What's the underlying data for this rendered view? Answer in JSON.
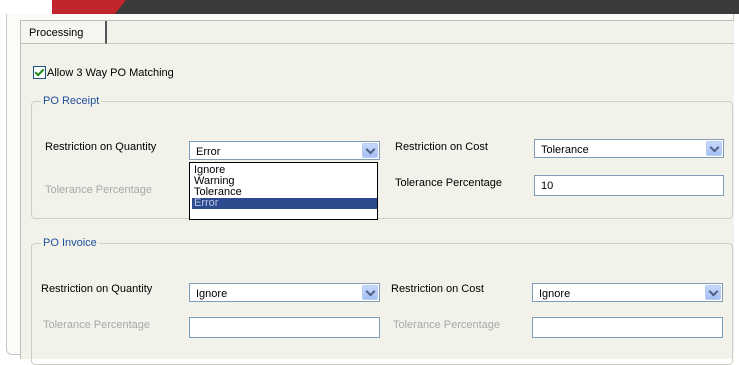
{
  "tabs": [
    {
      "label": "Processing"
    }
  ],
  "allow_3way": {
    "label": "Allow 3 Way PO Matching",
    "checked": true
  },
  "po_receipt": {
    "legend": "PO Receipt",
    "restriction_qty_label": "Restriction on Quantity",
    "restriction_qty_value": "Error",
    "tolerance_label_left": "Tolerance Percentage",
    "restriction_cost_label": "Restriction on Cost",
    "restriction_cost_value": "Tolerance",
    "tolerance_label_right": "Tolerance Percentage",
    "tolerance_value_right": "10"
  },
  "dropdown_options": [
    "Ignore",
    "Warning",
    "Tolerance",
    "Error"
  ],
  "dropdown_selected": "Error",
  "po_invoice": {
    "legend": "PO Invoice",
    "restriction_qty_label": "Restriction on Quantity",
    "restriction_qty_value": "Ignore",
    "tolerance_label_left": "Tolerance Percentage",
    "restriction_cost_label": "Restriction on Cost",
    "restriction_cost_value": "Ignore",
    "tolerance_label_right": "Tolerance Percentage"
  },
  "colors": {
    "legend": "#1f4f9c",
    "selection": "#2c4b8e",
    "accent": "#c0262c"
  }
}
